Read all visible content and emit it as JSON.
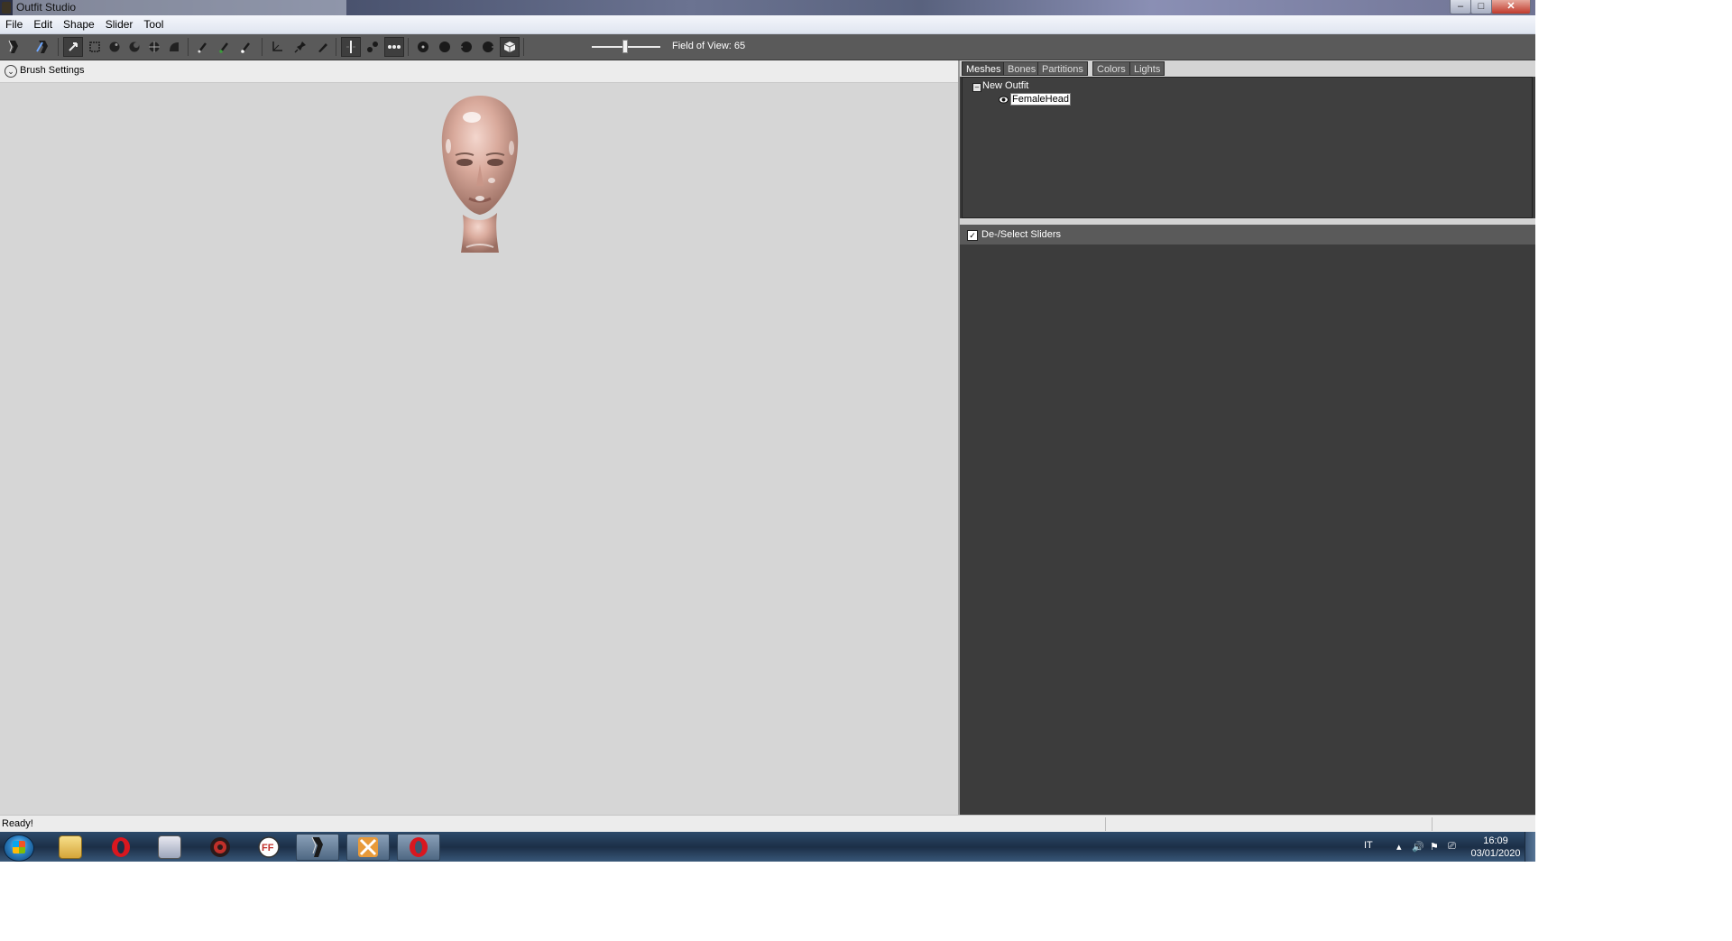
{
  "window": {
    "title": "Outfit Studio",
    "controls": {
      "minimize": "–",
      "maximize": "□",
      "close": "✕"
    }
  },
  "menubar": {
    "items": [
      "File",
      "Edit",
      "Shape",
      "Slider",
      "Tool"
    ]
  },
  "toolbar": {
    "icons": [
      "select-icon",
      "transform-icon",
      "mask-icon",
      "inflate-icon",
      "deflate-icon",
      "move-icon",
      "smooth-icon",
      "undiff-icon",
      "brush-icon",
      "weight-paint-icon",
      "color-paint-icon",
      "edge-icon",
      "pin-icon",
      "pen-icon",
      "mirror-icon",
      "connected-icon",
      "points-icon",
      "sphere1-icon",
      "sphere2-icon",
      "sphere3-icon",
      "sphere4-icon",
      "cube-icon"
    ],
    "fov_label": "Field of View: 65",
    "fov_value": 65
  },
  "viewport": {
    "brush_settings_label": "Brush Settings",
    "brush_toggle_glyph": "⌄",
    "background": "#d6d6d6"
  },
  "right_panel": {
    "tabs": [
      "Meshes",
      "Bones",
      "Partitions",
      "Colors",
      "Lights"
    ],
    "active_tab": "Meshes",
    "tree": {
      "expander": "–",
      "root_label": "New Outfit",
      "child_label": "FemaleHead"
    },
    "sliders": {
      "checkbox_glyph": "✓",
      "deselect_label": "De-/Select Sliders"
    }
  },
  "statusbar": {
    "text": "Ready!"
  },
  "taskbar": {
    "apps": [
      "explorer-icon",
      "opera-icon",
      "server-icon",
      "settings-icon",
      "ffdec-icon",
      "outfit-studio-icon",
      "vortex-icon",
      "opera-red-icon"
    ],
    "tray_lang": "IT",
    "tray_arrow": "▴",
    "tray_speaker": "🔊",
    "tray_flag": "⚑",
    "tray_network": "⎚",
    "clock_time": "16:09",
    "clock_date": "03/01/2020"
  },
  "colors": {
    "toolbar_bg": "#5a5a5a",
    "panel_bg": "#3c3c3c",
    "viewport_bg": "#d6d6d6",
    "accent_opera": "#d9171f"
  }
}
